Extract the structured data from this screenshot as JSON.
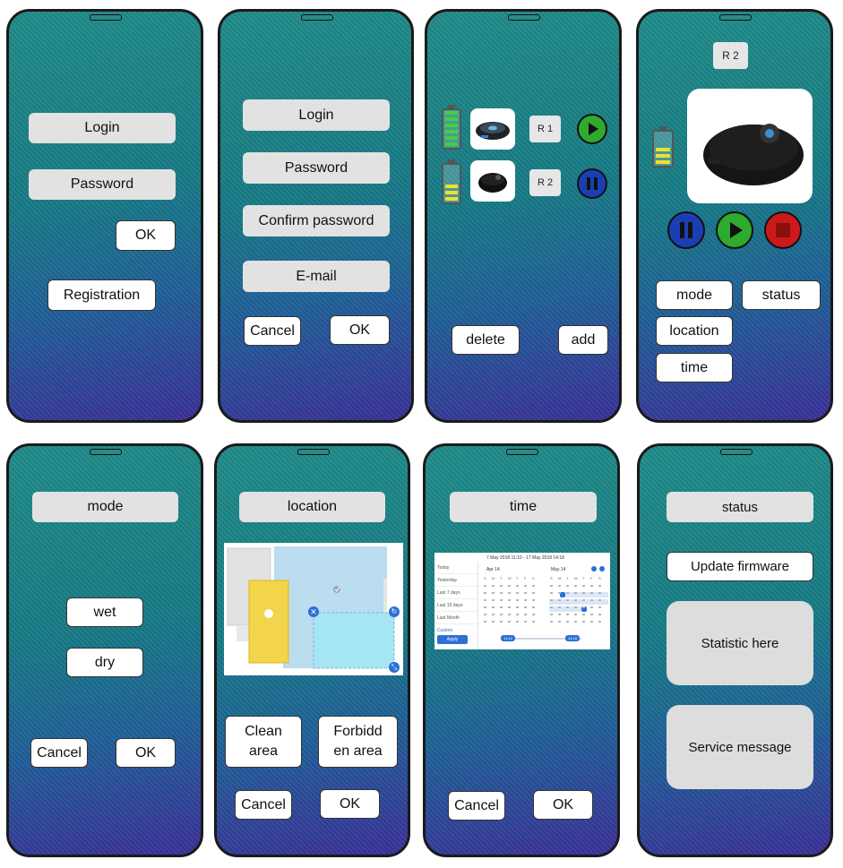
{
  "screens": {
    "login": {
      "login_field": "Login",
      "password_field": "Password",
      "ok": "OK",
      "registration": "Registration"
    },
    "register": {
      "login_field": "Login",
      "password_field": "Password",
      "confirm_field": "Confirm password",
      "email_field": "E-mail",
      "cancel": "Cancel",
      "ok": "OK"
    },
    "robots": {
      "r1_label": "R 1",
      "r2_label": "R 2",
      "delete": "delete",
      "add": "add",
      "r1_battery_level": 1.0,
      "r2_battery_level": 0.5
    },
    "robot_detail": {
      "title": "R 2",
      "mode": "mode",
      "status": "status",
      "location": "location",
      "time": "time",
      "battery_level": 0.5
    },
    "mode": {
      "title": "mode",
      "wet": "wet",
      "dry": "dry",
      "cancel": "Cancel",
      "ok": "OK"
    },
    "location": {
      "title": "location",
      "clean_area": "Clean area",
      "forbidden_area": "Forbidd en area",
      "cancel": "Cancel",
      "ok": "OK"
    },
    "time": {
      "title": "time",
      "range": "7 May 2018 11:10 - 17 May 2018 14:18",
      "presets": [
        "Today",
        "Yesterday",
        "Last 7 days",
        "Last 15 days",
        "Last Month",
        "Custom"
      ],
      "month_left": "Apr 14",
      "month_right": "May 14",
      "weekdays": [
        "S",
        "M",
        "T",
        "W",
        "T",
        "F",
        "S"
      ],
      "apply": "Apply",
      "time_from": "11:10",
      "time_to": "14:18",
      "cancel": "Cancel",
      "ok": "OK"
    },
    "status": {
      "title": "status",
      "update_firmware": "Update firmware",
      "statistic": "Statistic here",
      "service_message": "Service message"
    }
  },
  "colors": {
    "field_bg": "#e2e2e2",
    "button_bg": "#ffffff",
    "pause_blue": "#1a3fb5",
    "play_green": "#2eaa2e",
    "stop_red": "#cc1a1a",
    "battery_green": "#3fd13f",
    "battery_yellow": "#f0e02a",
    "calendar_accent": "#2d6fd6"
  },
  "icons": [
    "pause-icon",
    "play-icon",
    "stop-icon",
    "battery-icon",
    "robot-vacuum-image",
    "check-icon",
    "close-icon",
    "rotate-icon",
    "resize-icon"
  ]
}
